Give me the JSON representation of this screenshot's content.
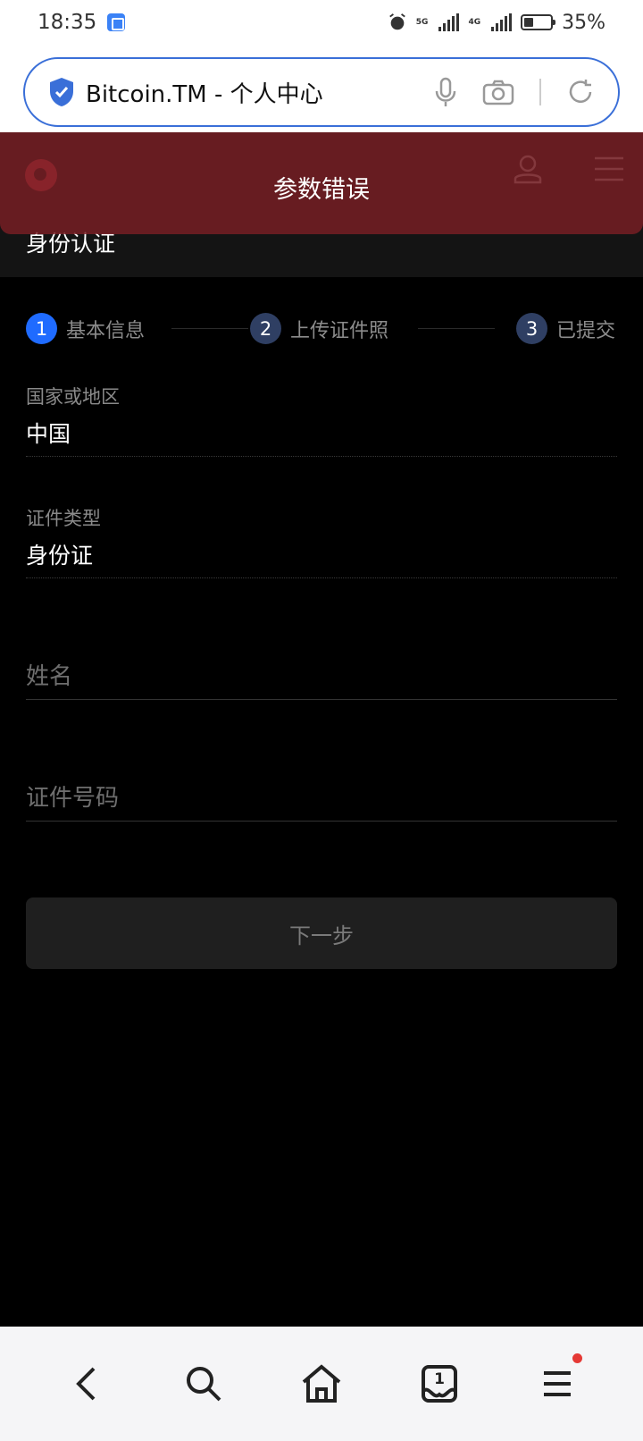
{
  "status_bar": {
    "time": "18:35",
    "battery": "35%",
    "signal_1": "5G",
    "signal_2": "4G",
    "battery_level": 0.35
  },
  "browser": {
    "url_title": "Bitcoin.TM - 个人中心"
  },
  "toast": {
    "message": "参数错误"
  },
  "page": {
    "title": "身份认证"
  },
  "steps": [
    {
      "number": "1",
      "label": "基本信息",
      "active": true
    },
    {
      "number": "2",
      "label": "上传证件照",
      "active": false
    },
    {
      "number": "3",
      "label": "已提交",
      "active": false
    }
  ],
  "form": {
    "country_label": "国家或地区",
    "country_value": "中国",
    "doc_type_label": "证件类型",
    "doc_type_value": "身份证",
    "name_placeholder": "姓名",
    "id_placeholder": "证件号码",
    "next_button": "下一步"
  },
  "colors": {
    "accent": "#1f6bff",
    "inactive_step": "#2f3f63",
    "toast_bg": "#7a1e24",
    "url_border": "#3a6fd8"
  },
  "bottom_nav": [
    "back-icon",
    "search-icon",
    "home-icon",
    "tabs-icon",
    "menu-icon"
  ],
  "tabs_count": "1"
}
